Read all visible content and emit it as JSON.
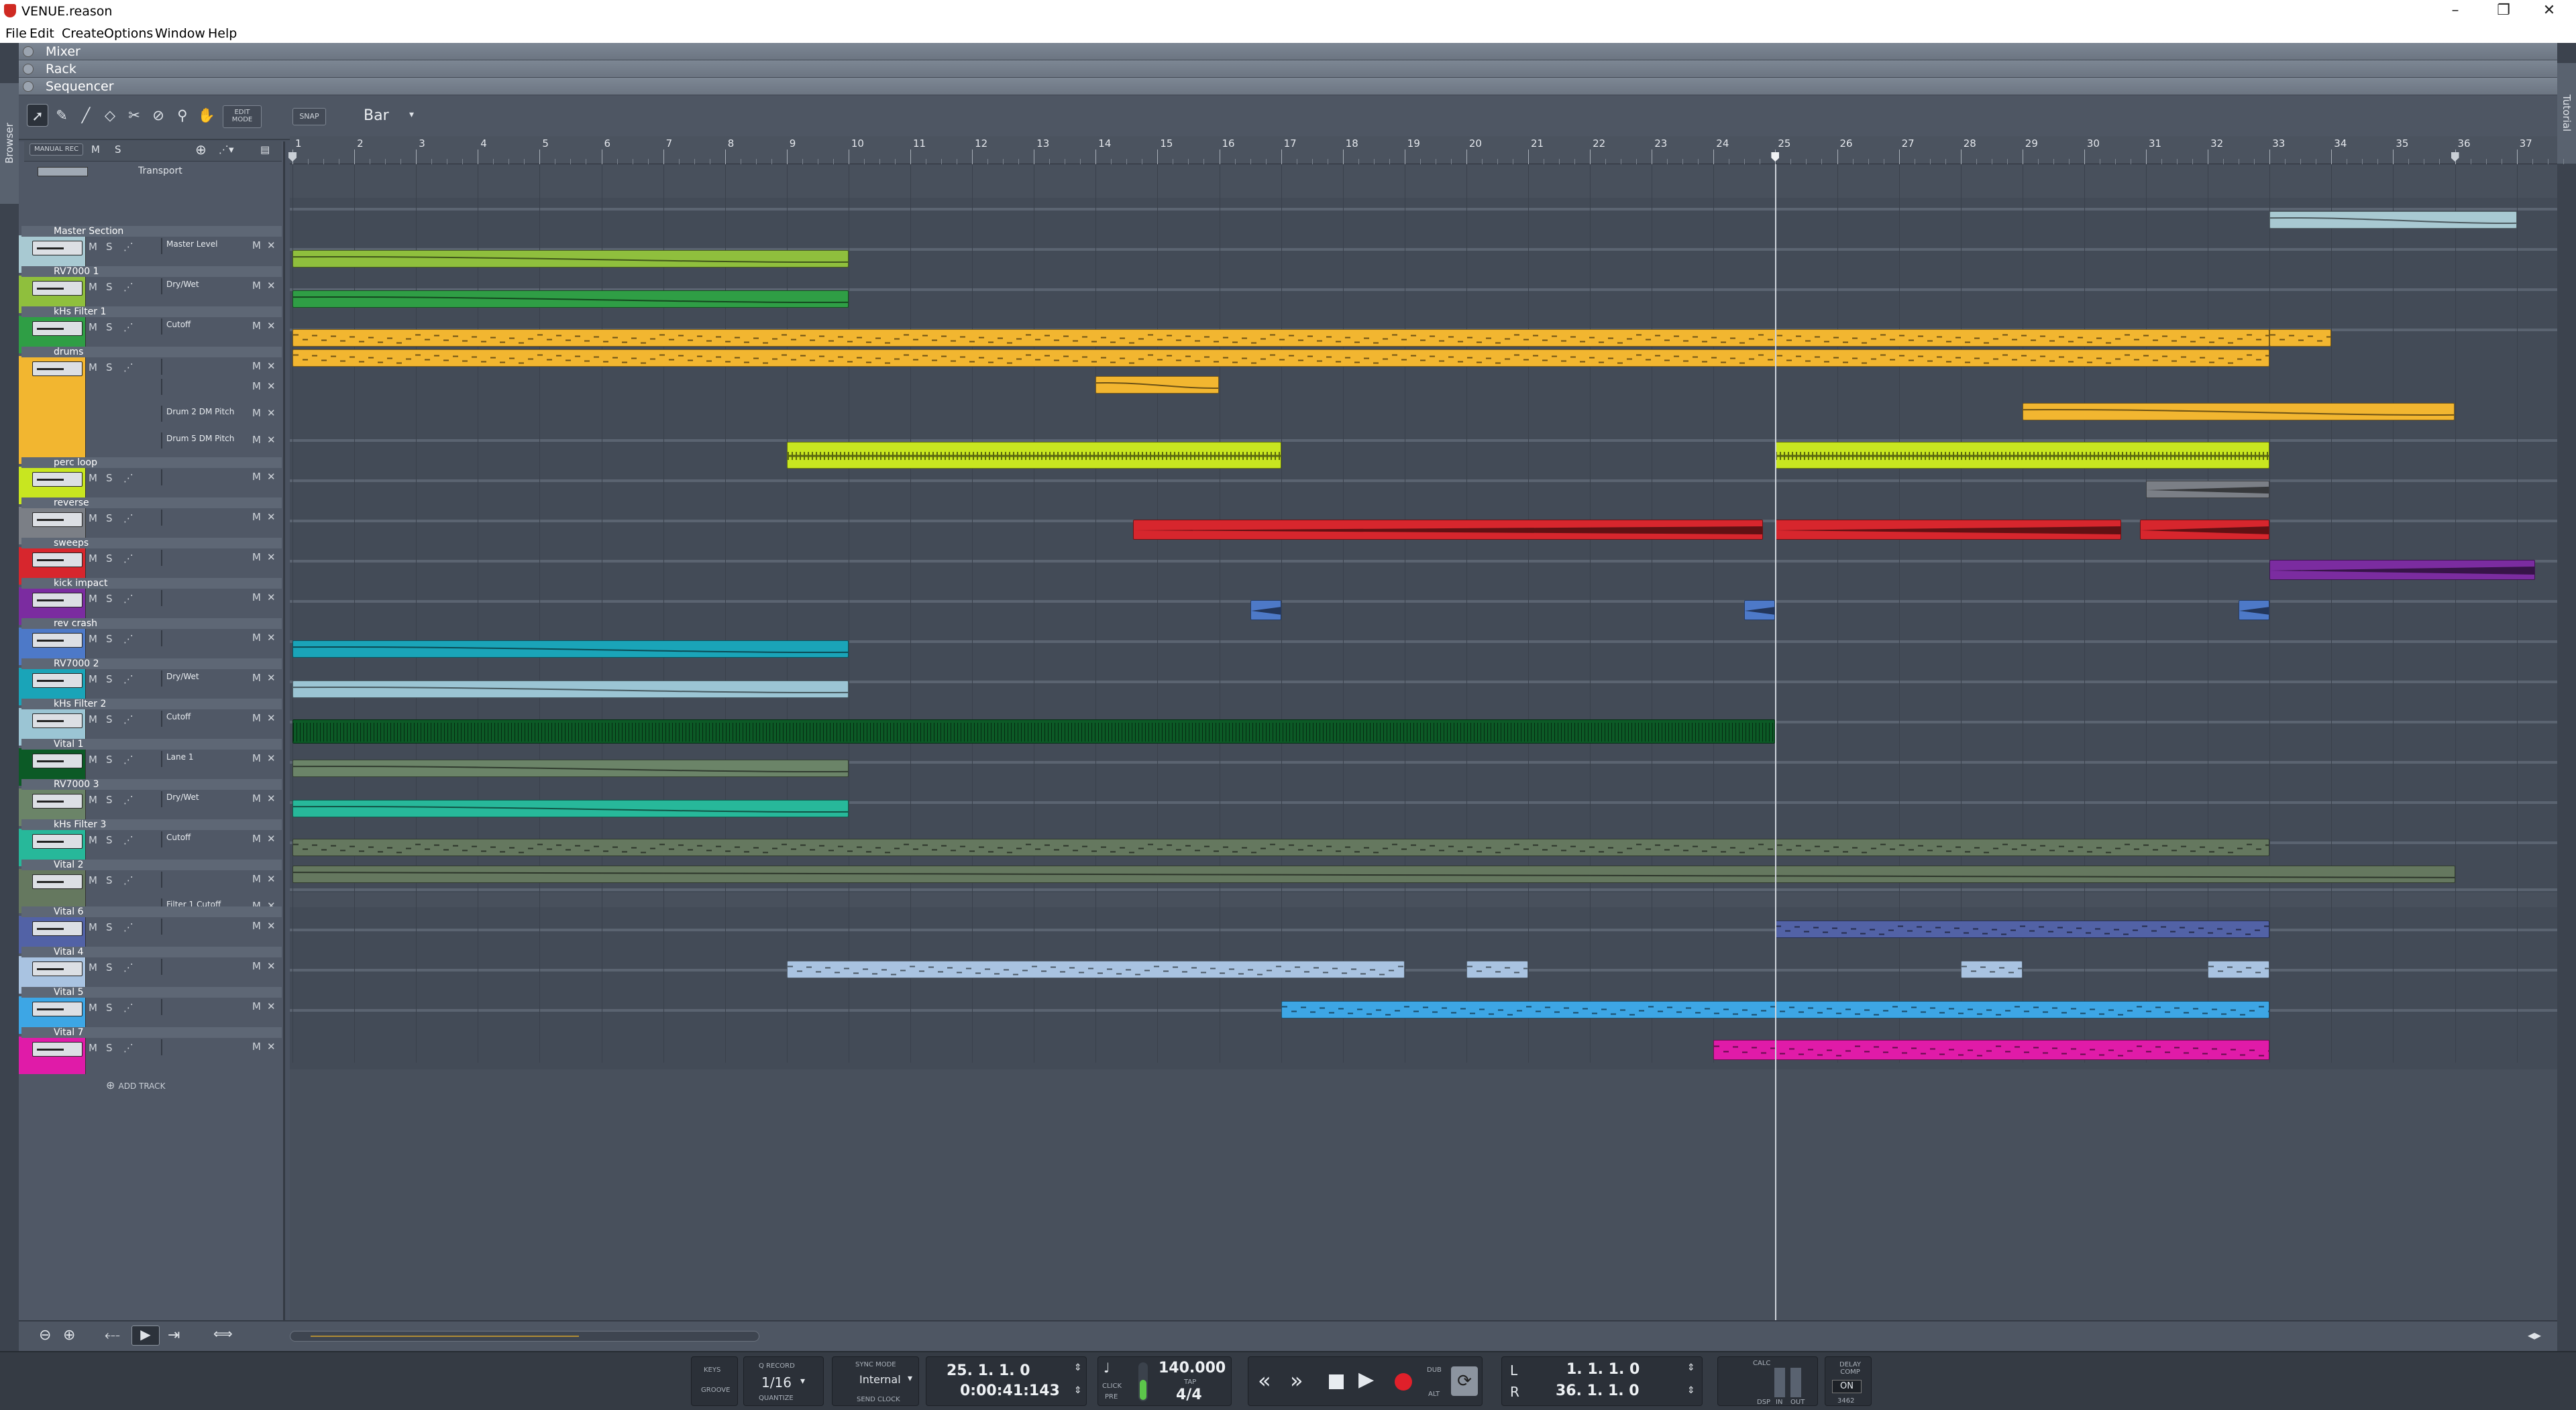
{
  "window": {
    "title": "VENUE.reason"
  },
  "menu": [
    "File",
    "Edit",
    "Create",
    "Options",
    "Window",
    "Help"
  ],
  "side": {
    "left": "Browser",
    "right": "Tutorial"
  },
  "sections": [
    "Mixer",
    "Rack",
    "Sequencer"
  ],
  "toolbar": {
    "edit_mode": "EDIT MODE",
    "snap": "SNAP",
    "snap_value": "Bar"
  },
  "header": {
    "manual_rec": "MANUAL REC",
    "m": "M",
    "s": "S",
    "transport_label": "Transport"
  },
  "ruler": {
    "bars": [
      "1",
      "2",
      "3",
      "4",
      "5",
      "6",
      "7",
      "8",
      "9",
      "10",
      "11",
      "12",
      "13",
      "14",
      "15",
      "16",
      "17",
      "18",
      "19",
      "20",
      "21",
      "22",
      "23",
      "24",
      "25",
      "26",
      "27",
      "28",
      "29",
      "30",
      "31",
      "32",
      "33",
      "34",
      "35",
      "36",
      "37"
    ]
  },
  "tracks": [
    {
      "name": "Master Section",
      "color": "#a8c9d2",
      "lanes": [
        "Master Level"
      ]
    },
    {
      "name": "RV7000 1",
      "color": "#8fbf3d",
      "lanes": [
        "Dry/Wet"
      ]
    },
    {
      "name": "kHs Filter 1",
      "color": "#2f9e45",
      "lanes": [
        "Cutoff"
      ]
    },
    {
      "name": "drums",
      "color": "#f2b630",
      "lanes": [
        "",
        "",
        "Drum 2 DM Pitch",
        "Drum 5 DM Pitch"
      ]
    },
    {
      "name": "perc loop",
      "color": "#c8e620",
      "lanes": [
        ""
      ]
    },
    {
      "name": "reverse",
      "color": "#7b7f86",
      "lanes": [
        ""
      ]
    },
    {
      "name": "sweeps",
      "color": "#d7262d",
      "lanes": [
        ""
      ]
    },
    {
      "name": "kick impact",
      "color": "#7b2ca0",
      "lanes": [
        ""
      ]
    },
    {
      "name": "rev crash",
      "color": "#4d79c8",
      "lanes": [
        ""
      ]
    },
    {
      "name": "RV7000 2",
      "color": "#1aa4b8",
      "lanes": [
        "Dry/Wet"
      ]
    },
    {
      "name": "kHs Filter 2",
      "color": "#9bc5d4",
      "lanes": [
        "Cutoff"
      ]
    },
    {
      "name": "Vital 1",
      "color": "#0c5a26",
      "lanes": [
        "Lane 1"
      ]
    },
    {
      "name": "RV7000 3",
      "color": "#6b8468",
      "lanes": [
        "Dry/Wet"
      ]
    },
    {
      "name": "kHs Filter 3",
      "color": "#27b89a",
      "lanes": [
        "Cutoff"
      ]
    },
    {
      "name": "Vital 2",
      "color": "#65785f",
      "lanes": [
        "",
        "Filter 1 Cutoff"
      ]
    },
    {
      "name": "Vital 6",
      "color": "#5262a6",
      "lanes": [
        ""
      ]
    },
    {
      "name": "Vital 4",
      "color": "#a9c3e1",
      "lanes": [
        ""
      ]
    },
    {
      "name": "Vital 5",
      "color": "#3da6e5",
      "lanes": [
        ""
      ]
    },
    {
      "name": "Vital 7",
      "color": "#e01ba8",
      "lanes": [
        ""
      ]
    }
  ],
  "add_track": "ADD TRACK",
  "transport": {
    "keys": "KEYS",
    "groove": "GROOVE",
    "q_record": "Q RECORD",
    "quantize_value": "1/16",
    "quantize": "QUANTIZE",
    "sync_mode": "SYNC MODE",
    "sync_value": "Internal",
    "send_clock": "SEND CLOCK",
    "position_bars": "25.  1.  1.    0",
    "position_time": "0:00:41:143",
    "click": "CLICK",
    "pre": "PRE",
    "tempo": "140.000",
    "tap": "TAP",
    "signature": "4/4",
    "dub": "DUB",
    "alt": "ALT",
    "l_label": "L",
    "r_label": "R",
    "loop_left": "1.  1.  1.    0",
    "loop_right": "36.  1.  1.    0",
    "dsp": "DSP",
    "in": "IN",
    "out": "OUT",
    "calc": "CALC",
    "delay_comp": "DELAY COMP",
    "on": "ON",
    "delay_value": "3462"
  }
}
